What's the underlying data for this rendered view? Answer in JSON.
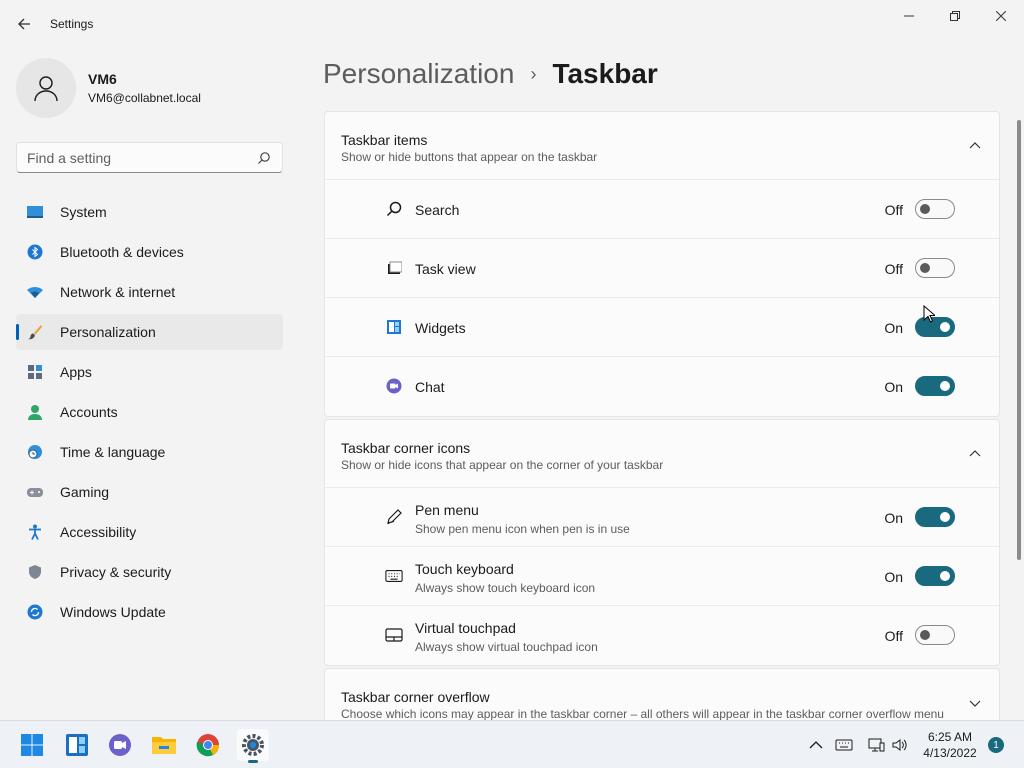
{
  "window": {
    "title": "Settings"
  },
  "profile": {
    "name": "VM6",
    "email": "VM6@collabnet.local"
  },
  "search": {
    "placeholder": "Find a setting"
  },
  "sidebar": {
    "items": [
      {
        "label": "System",
        "icon": "system-icon"
      },
      {
        "label": "Bluetooth & devices",
        "icon": "bluetooth-icon"
      },
      {
        "label": "Network & internet",
        "icon": "wifi-icon"
      },
      {
        "label": "Personalization",
        "icon": "brush-icon",
        "selected": true
      },
      {
        "label": "Apps",
        "icon": "apps-icon"
      },
      {
        "label": "Accounts",
        "icon": "person-icon"
      },
      {
        "label": "Time & language",
        "icon": "globe-clock-icon"
      },
      {
        "label": "Gaming",
        "icon": "gamepad-icon"
      },
      {
        "label": "Accessibility",
        "icon": "accessibility-icon"
      },
      {
        "label": "Privacy & security",
        "icon": "shield-icon"
      },
      {
        "label": "Windows Update",
        "icon": "update-icon"
      }
    ]
  },
  "breadcrumb": {
    "parent": "Personalization",
    "separator": "›",
    "current": "Taskbar"
  },
  "sections": {
    "taskbar_items": {
      "title": "Taskbar items",
      "subtitle": "Show or hide buttons that appear on the taskbar",
      "rows": [
        {
          "label": "Search",
          "state": "Off",
          "on": false,
          "icon": "search-icon"
        },
        {
          "label": "Task view",
          "state": "Off",
          "on": false,
          "icon": "task-view-icon"
        },
        {
          "label": "Widgets",
          "state": "On",
          "on": true,
          "icon": "widgets-icon"
        },
        {
          "label": "Chat",
          "state": "On",
          "on": true,
          "icon": "chat-icon"
        }
      ]
    },
    "corner_icons": {
      "title": "Taskbar corner icons",
      "subtitle": "Show or hide icons that appear on the corner of your taskbar",
      "rows": [
        {
          "label": "Pen menu",
          "sub": "Show pen menu icon when pen is in use",
          "state": "On",
          "on": true,
          "icon": "pen-icon"
        },
        {
          "label": "Touch keyboard",
          "sub": "Always show touch keyboard icon",
          "state": "On",
          "on": true,
          "icon": "keyboard-icon"
        },
        {
          "label": "Virtual touchpad",
          "sub": "Always show virtual touchpad icon",
          "state": "Off",
          "on": false,
          "icon": "touchpad-icon"
        }
      ]
    },
    "corner_overflow": {
      "title": "Taskbar corner overflow",
      "subtitle": "Choose which icons may appear in the taskbar corner – all others will appear in the taskbar corner overflow menu"
    }
  },
  "taskbar": {
    "apps": [
      "start-icon",
      "widgets-icon",
      "chat-icon",
      "file-explorer-icon",
      "chrome-icon",
      "settings-icon"
    ],
    "time": "6:25 AM",
    "date": "4/13/2022",
    "notifications": "1"
  },
  "colors": {
    "accent": "#1a6a7f",
    "selected_indicator": "#005fb8"
  }
}
